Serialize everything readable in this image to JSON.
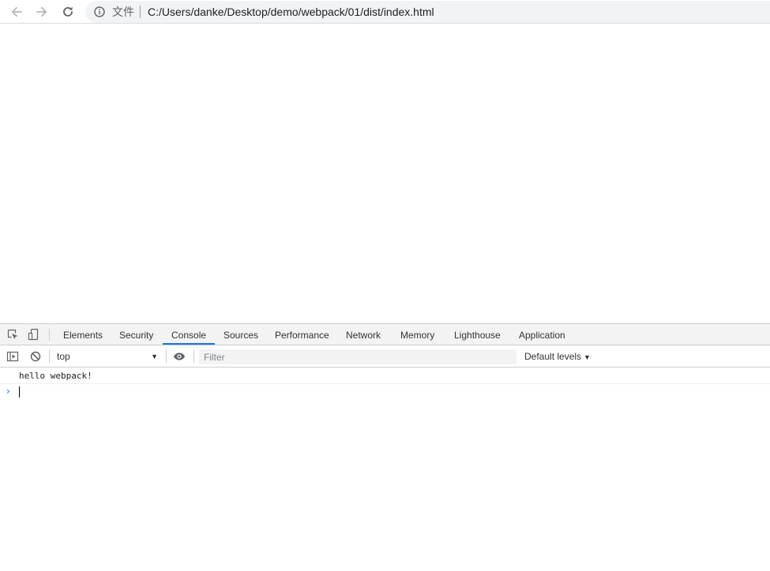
{
  "toolbar": {
    "scheme_label": "文件",
    "url": "C:/Users/danke/Desktop/demo/webpack/01/dist/index.html"
  },
  "devtools": {
    "tabs": [
      {
        "label": "Elements"
      },
      {
        "label": "Security"
      },
      {
        "label": "Console"
      },
      {
        "label": "Sources"
      },
      {
        "label": "Performance"
      },
      {
        "label": "Network"
      },
      {
        "label": "Memory"
      },
      {
        "label": "Lighthouse"
      },
      {
        "label": "Application"
      }
    ],
    "active_tab": "Console",
    "console_bar": {
      "context": "top",
      "filter_placeholder": "Filter",
      "levels": "Default levels"
    },
    "console": {
      "messages": [
        "hello webpack!"
      ]
    }
  },
  "colors": {
    "accent": "#1a73e8",
    "toolbar_bg": "#f3f3f3",
    "omnibox_bg": "#f1f3f4"
  }
}
